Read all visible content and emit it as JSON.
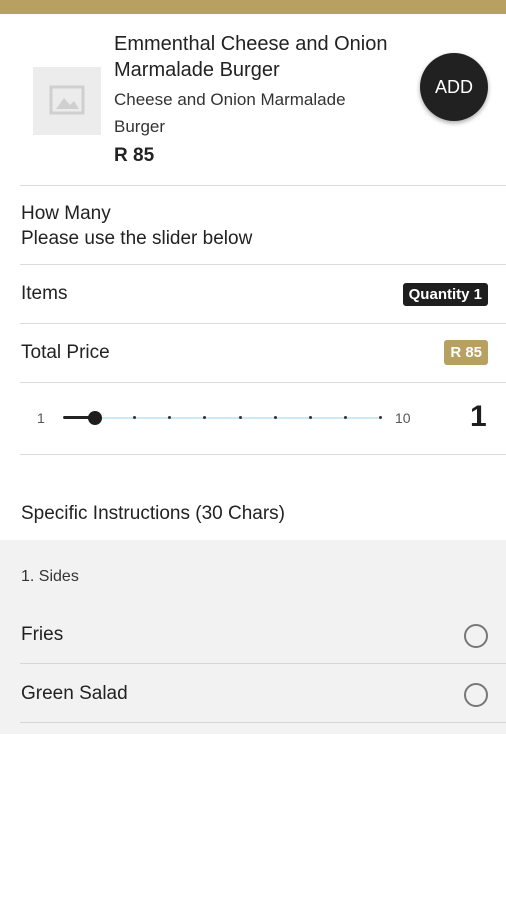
{
  "product": {
    "name": "Emmenthal Cheese and Onion Marmalade Burger",
    "description": "Cheese and Onion Marmalade Burger",
    "price": "R 85",
    "add_label": "ADD"
  },
  "how_many": {
    "title": "How Many",
    "subtitle": "Please use the slider below"
  },
  "items": {
    "label": "Items",
    "badge": "Quantity 1"
  },
  "total": {
    "label": "Total Price",
    "badge": "R 85"
  },
  "slider": {
    "min_label": "1",
    "max_label": "10",
    "min": 1,
    "max": 10,
    "value": 1,
    "value_label": "1"
  },
  "instructions": {
    "label": "Specific Instructions (30 Chars)"
  },
  "sides": {
    "title": "1. Sides",
    "options": [
      {
        "label": "Fries",
        "selected": false
      },
      {
        "label": "Green Salad",
        "selected": false
      }
    ]
  },
  "colors": {
    "accent": "#b8a060",
    "dark": "#1e1e1e"
  }
}
